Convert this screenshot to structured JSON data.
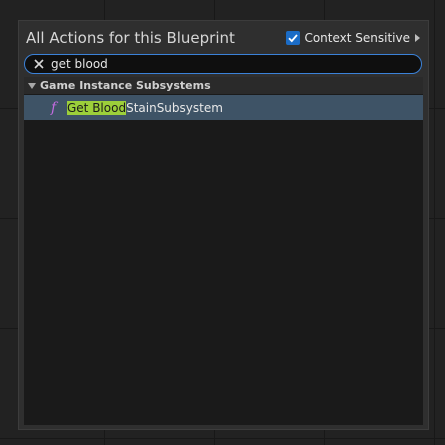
{
  "header": {
    "title": "All Actions for this Blueprint",
    "context_label": "Context Sensitive",
    "context_checked": true
  },
  "search": {
    "value": "get blood"
  },
  "results": {
    "category": "Game Instance Subsystems",
    "items": [
      {
        "match": "Get Blood",
        "rest": "StainSubsystem",
        "icon": "function-icon"
      }
    ]
  },
  "colors": {
    "accent": "#1b6cc6",
    "highlight": "#9ccf3a",
    "selected_row": "#3e5366",
    "function_icon": "#c46be0"
  }
}
